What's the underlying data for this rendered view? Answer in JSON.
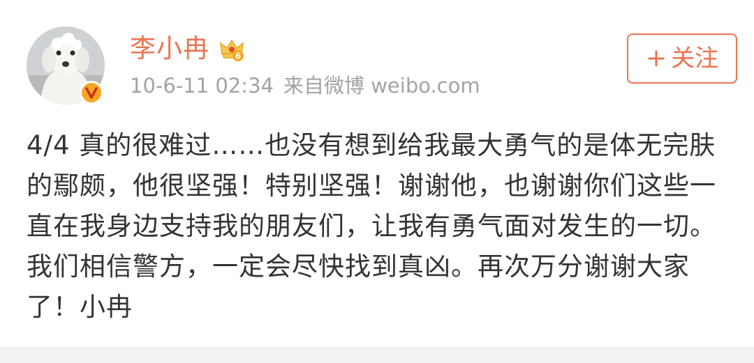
{
  "post": {
    "author": {
      "name": "李小冉",
      "avatar_icon": "poodle-dog-avatar",
      "verified_icon": "verified-v-badge",
      "vip_icon": "crown-vip-badge",
      "vip_level": "6"
    },
    "timestamp": "10-6-11 02:34",
    "source": "来自微博 weibo.com",
    "follow_button": {
      "plus": "+",
      "label": "关注"
    },
    "text": "4/4 真的很难过……也没有想到给我最大勇气的是体无完肤的鄢颇，他很坚强！特别坚强！谢谢他，也谢谢你们这些一直在我身边支持我的朋友们，让我有勇气面对发生的一切。我们相信警方，一定会尽快找到真凶。再次万分谢谢大家了！小冉"
  },
  "colors": {
    "accent": "#eb7350",
    "meta_text": "#a3a3a3",
    "body_text": "#333333",
    "verified": "#f5a623"
  }
}
